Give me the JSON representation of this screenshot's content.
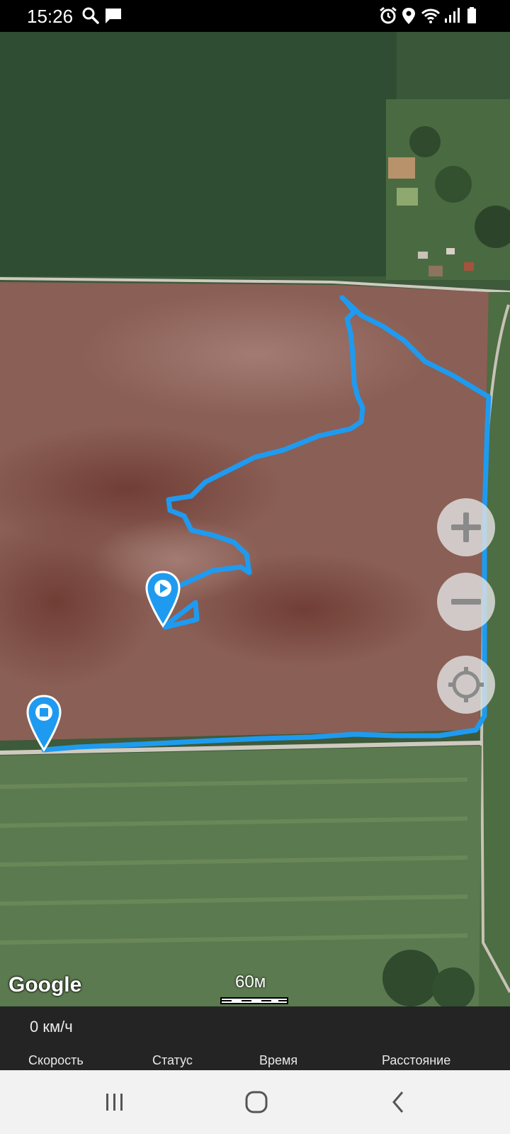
{
  "status_bar": {
    "time": "15:26",
    "left_icons": [
      "search-icon",
      "message-icon"
    ],
    "right_icons": [
      "alarm-icon",
      "location-icon",
      "wifi-icon",
      "signal-icon",
      "battery-icon"
    ]
  },
  "map": {
    "provider_logo": "Google",
    "scale_label": "60м",
    "route_color": "#1e9bf0",
    "markers": [
      {
        "name": "start-marker",
        "icon": "play-icon"
      },
      {
        "name": "end-marker",
        "icon": "stop-icon"
      }
    ],
    "controls": [
      {
        "name": "zoom-in-button",
        "icon": "plus-icon"
      },
      {
        "name": "zoom-out-button",
        "icon": "minus-icon"
      },
      {
        "name": "my-location-button",
        "icon": "crosshair-icon"
      }
    ]
  },
  "info_panel": {
    "speed_value": "0 км/ч",
    "labels": {
      "speed": "Скорость",
      "status": "Статус",
      "time": "Время",
      "distance": "Расстояние"
    }
  },
  "nav_bar": {
    "buttons": [
      "recent-apps-icon",
      "home-icon",
      "back-icon"
    ]
  }
}
